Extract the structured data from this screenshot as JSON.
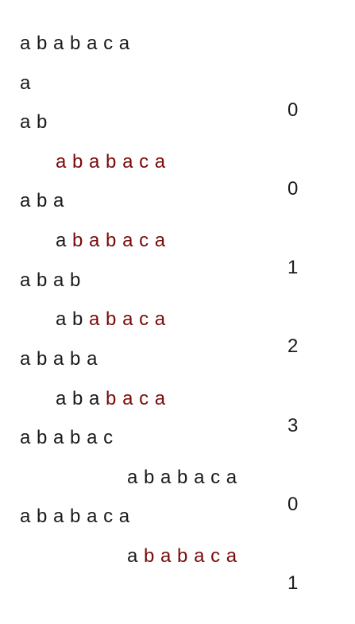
{
  "pattern": "a b a b a c a",
  "rows": [
    {
      "prefix": "a",
      "value": "0"
    },
    {
      "prefix": "a b",
      "alignment_matched": "",
      "alignment_rest": "a b a b a c a",
      "value": "0"
    },
    {
      "prefix": "a b a",
      "alignment_matched": "a ",
      "alignment_rest": "b a b a c a",
      "value": "1"
    },
    {
      "prefix": "a b a b",
      "alignment_matched": "a b ",
      "alignment_rest": "a b a c a",
      "value": "2"
    },
    {
      "prefix": "a b a b a",
      "alignment_matched": "a b a ",
      "alignment_rest": "b a c a",
      "value": "3"
    },
    {
      "prefix": "a b a b a c",
      "alignment_matched": "a b a b a c a",
      "alignment_rest": "",
      "value": "0"
    },
    {
      "prefix": "a b a b a c a",
      "alignment_matched": "a ",
      "alignment_rest": "b a b a c a",
      "value": "1"
    }
  ],
  "colors": {
    "text": "#1a1a1a",
    "unmatched_highlight": "#7a0a0a"
  }
}
